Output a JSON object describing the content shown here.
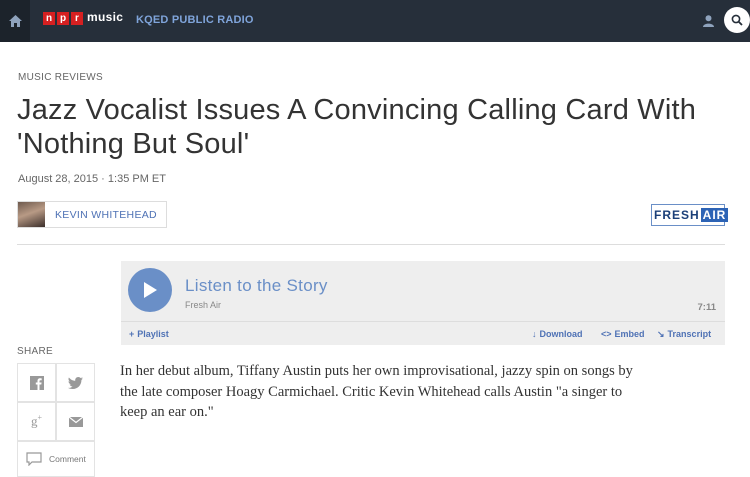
{
  "nav": {
    "logo_letters": [
      "n",
      "p",
      "r"
    ],
    "logo_section": "music",
    "station": "KQED PUBLIC RADIO"
  },
  "article": {
    "slug": "MUSIC REVIEWS",
    "title": "Jazz Vocalist Issues A Convincing Calling Card With 'Nothing But Soul'",
    "dateline": "August 28, 2015 · 1:35 PM ET",
    "author": "KEVIN WHITEHEAD",
    "program_logo": "FRESH AIR",
    "teaser": "In her debut album, Tiffany Austin puts her own improvisational, jazzy spin on songs by the late composer Hoagy Carmichael. Critic Kevin Whitehead calls Austin \"a singer to keep an ear on.\""
  },
  "player": {
    "title": "Listen to the Story",
    "program": "Fresh Air",
    "duration": "7:11",
    "tools": {
      "playlist": "Playlist",
      "download": "Download",
      "embed": "Embed",
      "transcript": "Transcript"
    }
  },
  "share": {
    "label": "SHARE",
    "comment": "Comment",
    "icons": [
      "facebook-icon",
      "twitter-icon",
      "google-plus-icon",
      "email-icon",
      "comment-icon"
    ]
  },
  "colors": {
    "nav_bg": "#262f3a",
    "accent_blue": "#6a8fc7",
    "link_blue": "#4f72b5",
    "npr_red": "#d62021"
  }
}
